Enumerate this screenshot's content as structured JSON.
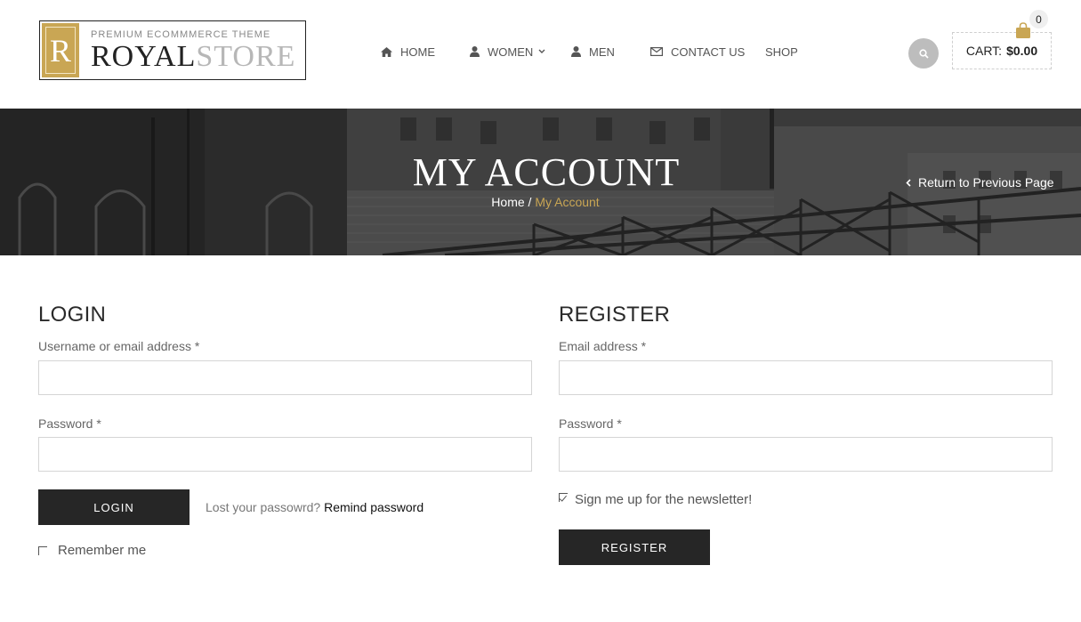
{
  "header": {
    "logo": {
      "initial": "R",
      "tagline": "PREMIUM ECOMMMERCE THEME",
      "word_primary": "ROYAL",
      "word_secondary": "STORE"
    },
    "nav": [
      {
        "label": "HOME",
        "icon": "home-icon"
      },
      {
        "label": "WOMEN",
        "icon": "user-icon",
        "dropdown": true
      },
      {
        "label": "MEN",
        "icon": "user-icon"
      },
      {
        "label": "CONTACT US",
        "icon": "envelope-icon"
      },
      {
        "label": "SHOP"
      }
    ],
    "search_icon": "search-icon",
    "cart": {
      "label": "CART:",
      "amount": "$0.00",
      "count": "0",
      "icon": "shopping-bag-icon"
    }
  },
  "banner": {
    "title": "MY ACCOUNT",
    "breadcrumb": {
      "home": "Home",
      "separator": " / ",
      "current": "My Account"
    },
    "return_link": "Return to Previous Page"
  },
  "login": {
    "title": "LOGIN",
    "username_label": "Username or email address",
    "password_label": "Password",
    "required_mark": "*",
    "button": "LOGIN",
    "lost_text": "Lost your passowrd?",
    "remind_link": "Remind password",
    "remember_label": "Remember me"
  },
  "register": {
    "title": "REGISTER",
    "email_label": "Email address",
    "password_label": "Password",
    "required_mark": "*",
    "newsletter_label": "Sign me up for the newsletter!",
    "newsletter_checked": true,
    "button": "REGISTER"
  },
  "colors": {
    "accent": "#c9a654",
    "button": "#262626",
    "banner": "#4a4a4a"
  }
}
